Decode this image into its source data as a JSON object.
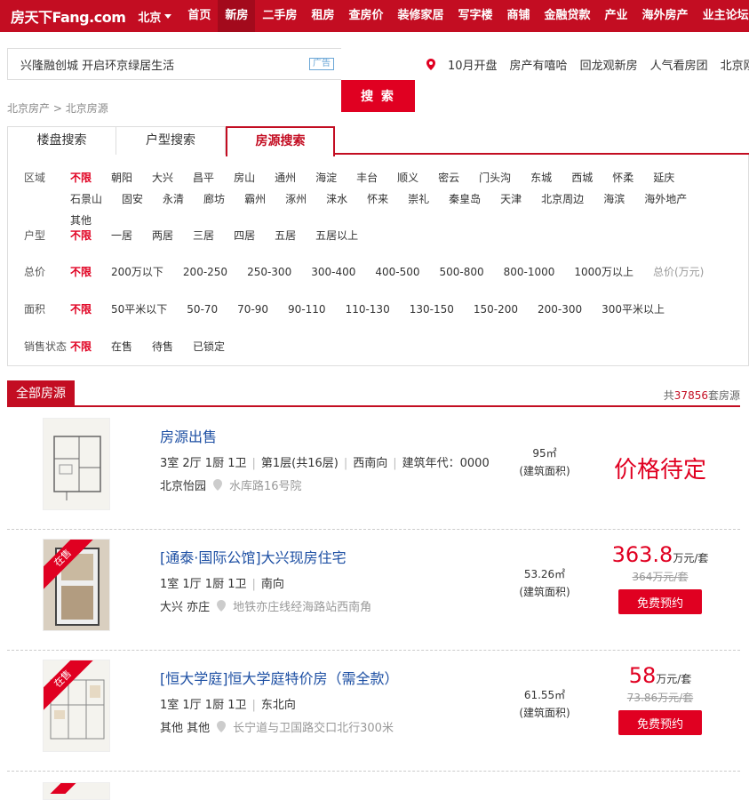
{
  "header": {
    "logo": "房天下Fang.com",
    "city": "北京",
    "nav": [
      "首页",
      "新房",
      "二手房",
      "租房",
      "查房价",
      "装修家居",
      "写字楼",
      "商铺",
      "金融贷款",
      "产业",
      "海外房产",
      "业主论坛"
    ],
    "active_nav": "新房"
  },
  "search": {
    "value": "兴隆融创城 开启环京绿居生活",
    "ad_badge": "广告",
    "button": "搜 索",
    "hot_links": [
      "10月开盘",
      "房产有嘻哈",
      "回龙观新房",
      "人气看房团",
      "北京刚"
    ]
  },
  "breadcrumb": {
    "home": "北京房产",
    "sep": ">",
    "current": "北京房源"
  },
  "tabs": [
    "楼盘搜索",
    "户型搜索",
    "房源搜索"
  ],
  "filters": {
    "district": {
      "label": "区域",
      "options": [
        "不限",
        "朝阳",
        "大兴",
        "昌平",
        "房山",
        "通州",
        "海淀",
        "丰台",
        "顺义",
        "密云",
        "门头沟",
        "东城",
        "西城",
        "怀柔",
        "延庆",
        "石景山",
        "固安",
        "永清",
        "廊坊",
        "霸州",
        "涿州",
        "涞水",
        "怀来",
        "崇礼",
        "秦皇岛",
        "天津",
        "北京周边",
        "海滨",
        "海外地产",
        "其他"
      ]
    },
    "layout": {
      "label": "户型",
      "options": [
        "不限",
        "一居",
        "两居",
        "三居",
        "四居",
        "五居",
        "五居以上"
      ]
    },
    "price": {
      "label": "总价",
      "options": [
        "不限",
        "200万以下",
        "200-250",
        "250-300",
        "300-400",
        "400-500",
        "500-800",
        "800-1000",
        "1000万以上"
      ],
      "note": "总价(万元)"
    },
    "area": {
      "label": "面积",
      "options": [
        "不限",
        "50平米以下",
        "50-70",
        "70-90",
        "90-110",
        "110-130",
        "130-150",
        "150-200",
        "200-300",
        "300平米以上"
      ]
    },
    "status": {
      "label": "销售状态",
      "options": [
        "不限",
        "在售",
        "待售",
        "已锁定"
      ]
    }
  },
  "section": {
    "title": "全部房源",
    "count_prefix": "共",
    "count": "37856",
    "count_suffix": "套房源"
  },
  "listings": [
    {
      "title": "房源出售",
      "detail": [
        "3室 2厅 1厨 1卫",
        "第1层(共16层)",
        "西南向",
        "建筑年代：0000"
      ],
      "district": "北京怡园",
      "address": "水库路16号院",
      "area": "95㎡",
      "area_label": "(建筑面积)",
      "price_text": "价格待定"
    },
    {
      "badge": "在售",
      "title": "[通泰·国际公馆]大兴现房住宅",
      "detail": [
        "1室 1厅 1厨 1卫",
        "南向"
      ],
      "district": "大兴 亦庄",
      "address": "地铁亦庄线经海路站西南角",
      "area": "53.26㎡",
      "area_label": "(建筑面积)",
      "price": "363.8",
      "unit": "万元/套",
      "old_price": "364万元/套",
      "button": "免费预约"
    },
    {
      "badge": "在售",
      "title": "[恒大学庭]恒大学庭特价房（需全款）",
      "detail": [
        "1室 1厅 1厨 1卫",
        "东北向"
      ],
      "district": "其他 其他",
      "address": "长宁道与卫国路交口北行300米",
      "area": "61.55㎡",
      "area_label": "(建筑面积)",
      "price": "58",
      "unit": "万元/套",
      "old_price": "73.86万元/套",
      "button": "免费预约"
    }
  ],
  "colors": {
    "brand": "#c30d22",
    "accent": "#e00021",
    "link": "#1d4fa3"
  }
}
